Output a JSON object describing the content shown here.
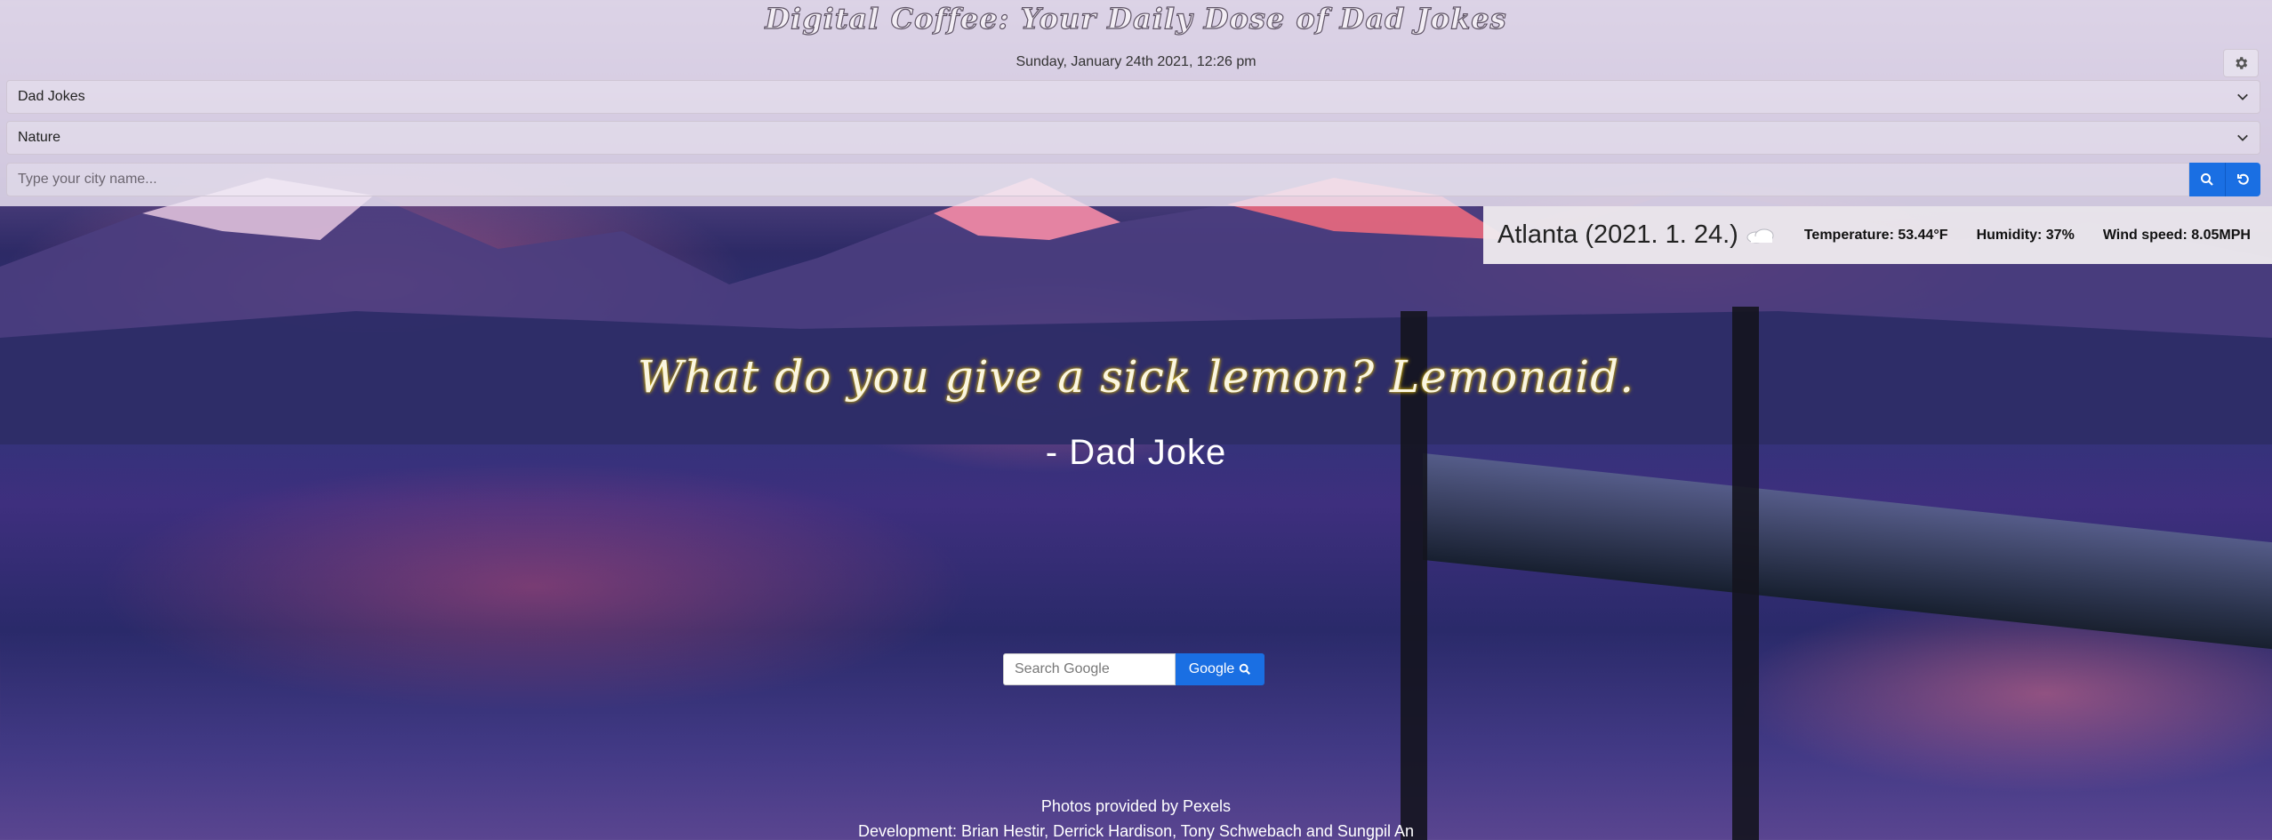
{
  "header": {
    "title": "Digital Coffee: Your Daily Dose of Dad Jokes",
    "datetime": "Sunday, January 24th 2021, 12:26 pm"
  },
  "settings": {
    "icon": "gear-icon"
  },
  "selects": {
    "quote_category": "Dad Jokes",
    "background_category": "Nature"
  },
  "city_search": {
    "placeholder": "Type your city name...",
    "search_icon": "search-icon",
    "reset_icon": "refresh-icon"
  },
  "weather": {
    "city_date": "Atlanta (2021. 1. 24.)",
    "icon": "cloud-icon",
    "temperature": "Temperature: 53.44°F",
    "humidity": "Humidity: 37%",
    "wind": "Wind speed: 8.05MPH"
  },
  "quote": {
    "text": "What do you give a sick lemon? Lemonaid.",
    "author": "- Dad Joke"
  },
  "google_search": {
    "placeholder": "Search Google",
    "button_label": "Google"
  },
  "footer": {
    "photos_credit": "Photos provided by Pexels",
    "development_credit": "Development: Brian Hestir, Derrick Hardison, Tony Schwebach and Sungpil An"
  },
  "colors": {
    "accent": "#1a6fe3",
    "overlay": "#eee6f4",
    "quote_glow": "#d4b300"
  }
}
